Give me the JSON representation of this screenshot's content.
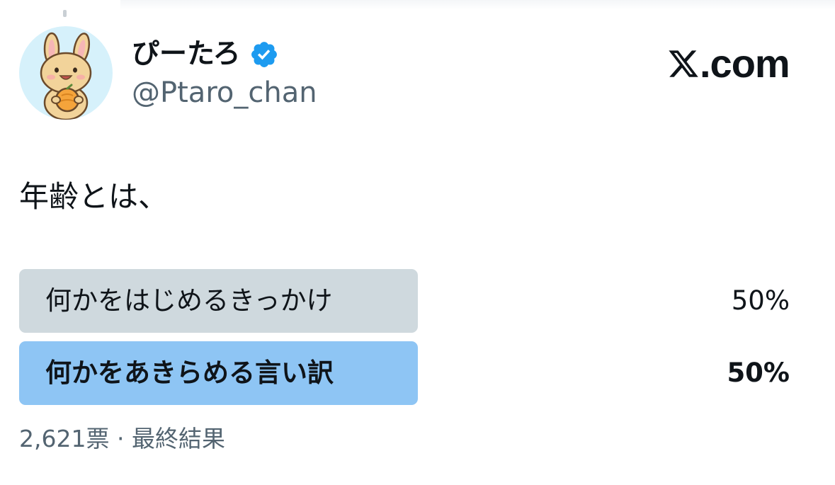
{
  "author": {
    "display_name": "ぴーたろ",
    "handle": "@Ptaro_chan",
    "verified_icon": "verified-badge-icon",
    "avatar_icon": "bunny-holding-orange-avatar"
  },
  "brand": {
    "domain": ".com",
    "logo_icon": "x-logo-icon"
  },
  "tweet": {
    "text": "年齢とは、"
  },
  "poll": {
    "options": [
      {
        "label": "何かをはじめるきっかけ",
        "percent_text": "50%",
        "share": 0.5,
        "winner": false
      },
      {
        "label": "何かをあきらめる言い訳",
        "percent_text": "50%",
        "share": 0.5,
        "winner": true
      }
    ],
    "votes": "2,621票",
    "separator": "·",
    "status": "最終結果"
  },
  "colors": {
    "verified": "#1d9bf0",
    "winner_bar": "#8ec5f4",
    "other_bar": "#cfd9de",
    "secondary_text": "#536471",
    "primary_text": "#0f1419"
  }
}
